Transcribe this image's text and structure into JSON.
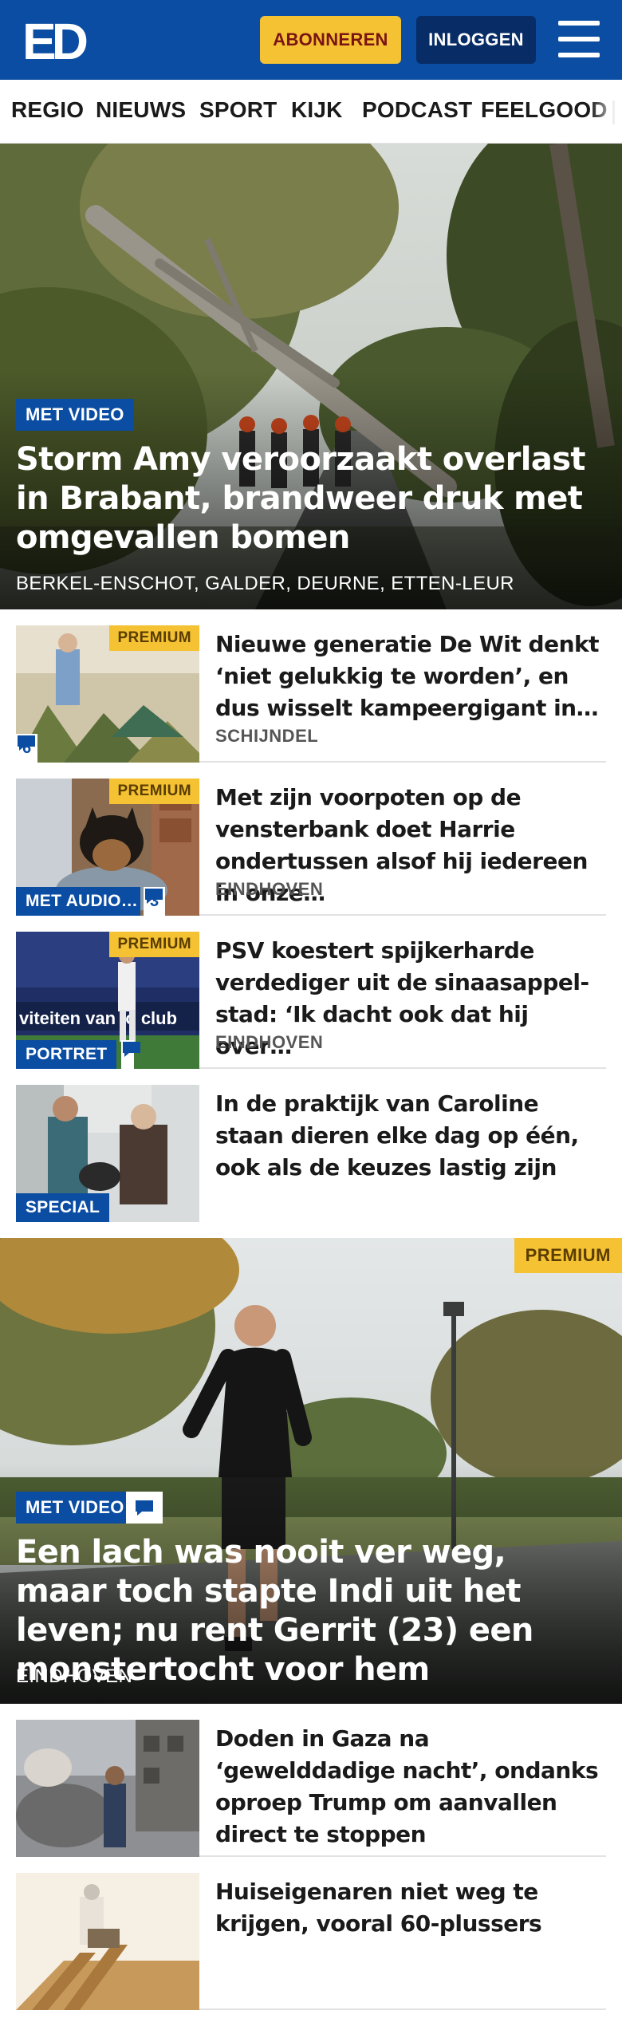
{
  "header": {
    "logo_text": "ED",
    "subscribe_label": "ABONNEREN",
    "login_label": "INLOGGEN",
    "brand_color": "#0a4da3",
    "accent_color": "#f4c233",
    "menu_icon": "hamburger-icon"
  },
  "nav": {
    "items": [
      "REGIO",
      "NIEUWS",
      "SPORT",
      "KIJK",
      "PODCAST",
      "FEELGOOD"
    ]
  },
  "hero1": {
    "tag": "MET VIDEO",
    "title": "Storm Amy veroorzaakt overlast in Brabant, brandweer druk met omgevallen bomen",
    "location": "BERKEL-ENSCHOT, GALDER, DEURNE, ETTEN-LEUR"
  },
  "articles": [
    {
      "premium": "PREMIUM",
      "comments": "6",
      "title": "Nieuwe generatie De Wit denkt ‘niet gelukkig te worden’, en dus wisselt kampeergigant in…",
      "location": "SCHIJNDEL"
    },
    {
      "premium": "PREMIUM",
      "label": "MET AUDIO…",
      "comments": "3",
      "title": "Met zijn voorpoten op de venster­bank doet Harrie ondertussen alsof hij iedereen in onze…",
      "location": "EINDHOVEN"
    },
    {
      "premium": "PREMIUM",
      "label": "PORTRET",
      "title": "PSV koestert spijkerharde verdediger uit de sinaasappel­stad: ‘Ik dacht ook dat hij over…",
      "location": "EINDHOVEN"
    },
    {
      "label": "SPECIAL",
      "title": "In de praktijk van Caroline staan dieren elke dag op één, ook als de keuzes lastig zijn"
    }
  ],
  "hero2": {
    "premium": "PREMIUM",
    "tag": "MET VIDEO",
    "title": "Een lach was nooit ver weg, maar toch stapte Indi uit het leven; nu rent Gerrit (23) een monstertocht voor hem",
    "location": "EINDHOVEN"
  },
  "articles2": [
    {
      "title": "Doden in Gaza na ‘gewelddadige nacht’, ondanks oproep Trump om aanvallen direct te stoppen"
    },
    {
      "title": "Huiseigenaren niet weg te krijgen, vooral 60-plussers"
    }
  ]
}
